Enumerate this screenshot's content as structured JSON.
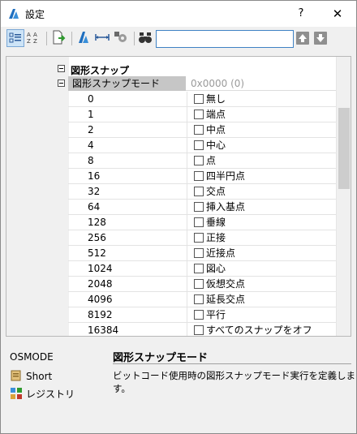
{
  "window": {
    "title": "設定",
    "help_label": "?",
    "close_label": "✕"
  },
  "toolbar": {
    "buttons": [
      "categorized-icon",
      "alphabetical-icon",
      "export-icon",
      "app-settings-icon",
      "dimension-icon",
      "gear-settings-icon",
      "binoculars-icon"
    ],
    "search_value": "",
    "nav_up": "arrow-up-icon",
    "nav_down": "arrow-down-icon"
  },
  "tree": {
    "group_label": "図形スナップ",
    "sub_label": "図形スナップモード",
    "sub_value": "0x0000 (0)",
    "rows": [
      {
        "num": "0",
        "label": "無し"
      },
      {
        "num": "1",
        "label": "端点"
      },
      {
        "num": "2",
        "label": "中点"
      },
      {
        "num": "4",
        "label": "中心"
      },
      {
        "num": "8",
        "label": "点"
      },
      {
        "num": "16",
        "label": "四半円点"
      },
      {
        "num": "32",
        "label": "交点"
      },
      {
        "num": "64",
        "label": "挿入基点"
      },
      {
        "num": "128",
        "label": "垂線"
      },
      {
        "num": "256",
        "label": "正接"
      },
      {
        "num": "512",
        "label": "近接点"
      },
      {
        "num": "1024",
        "label": "図心"
      },
      {
        "num": "2048",
        "label": "仮想交点"
      },
      {
        "num": "4096",
        "label": "延長交点"
      },
      {
        "num": "8192",
        "label": "平行"
      },
      {
        "num": "16384",
        "label": "すべてのスナップをオフ"
      }
    ]
  },
  "info": {
    "variable_name": "OSMODE",
    "view_short": "Short",
    "view_registry": "レジストリ",
    "description_title": "図形スナップモード",
    "description_text": "ビットコード使用時の図形スナップモード実行を定義します。"
  }
}
